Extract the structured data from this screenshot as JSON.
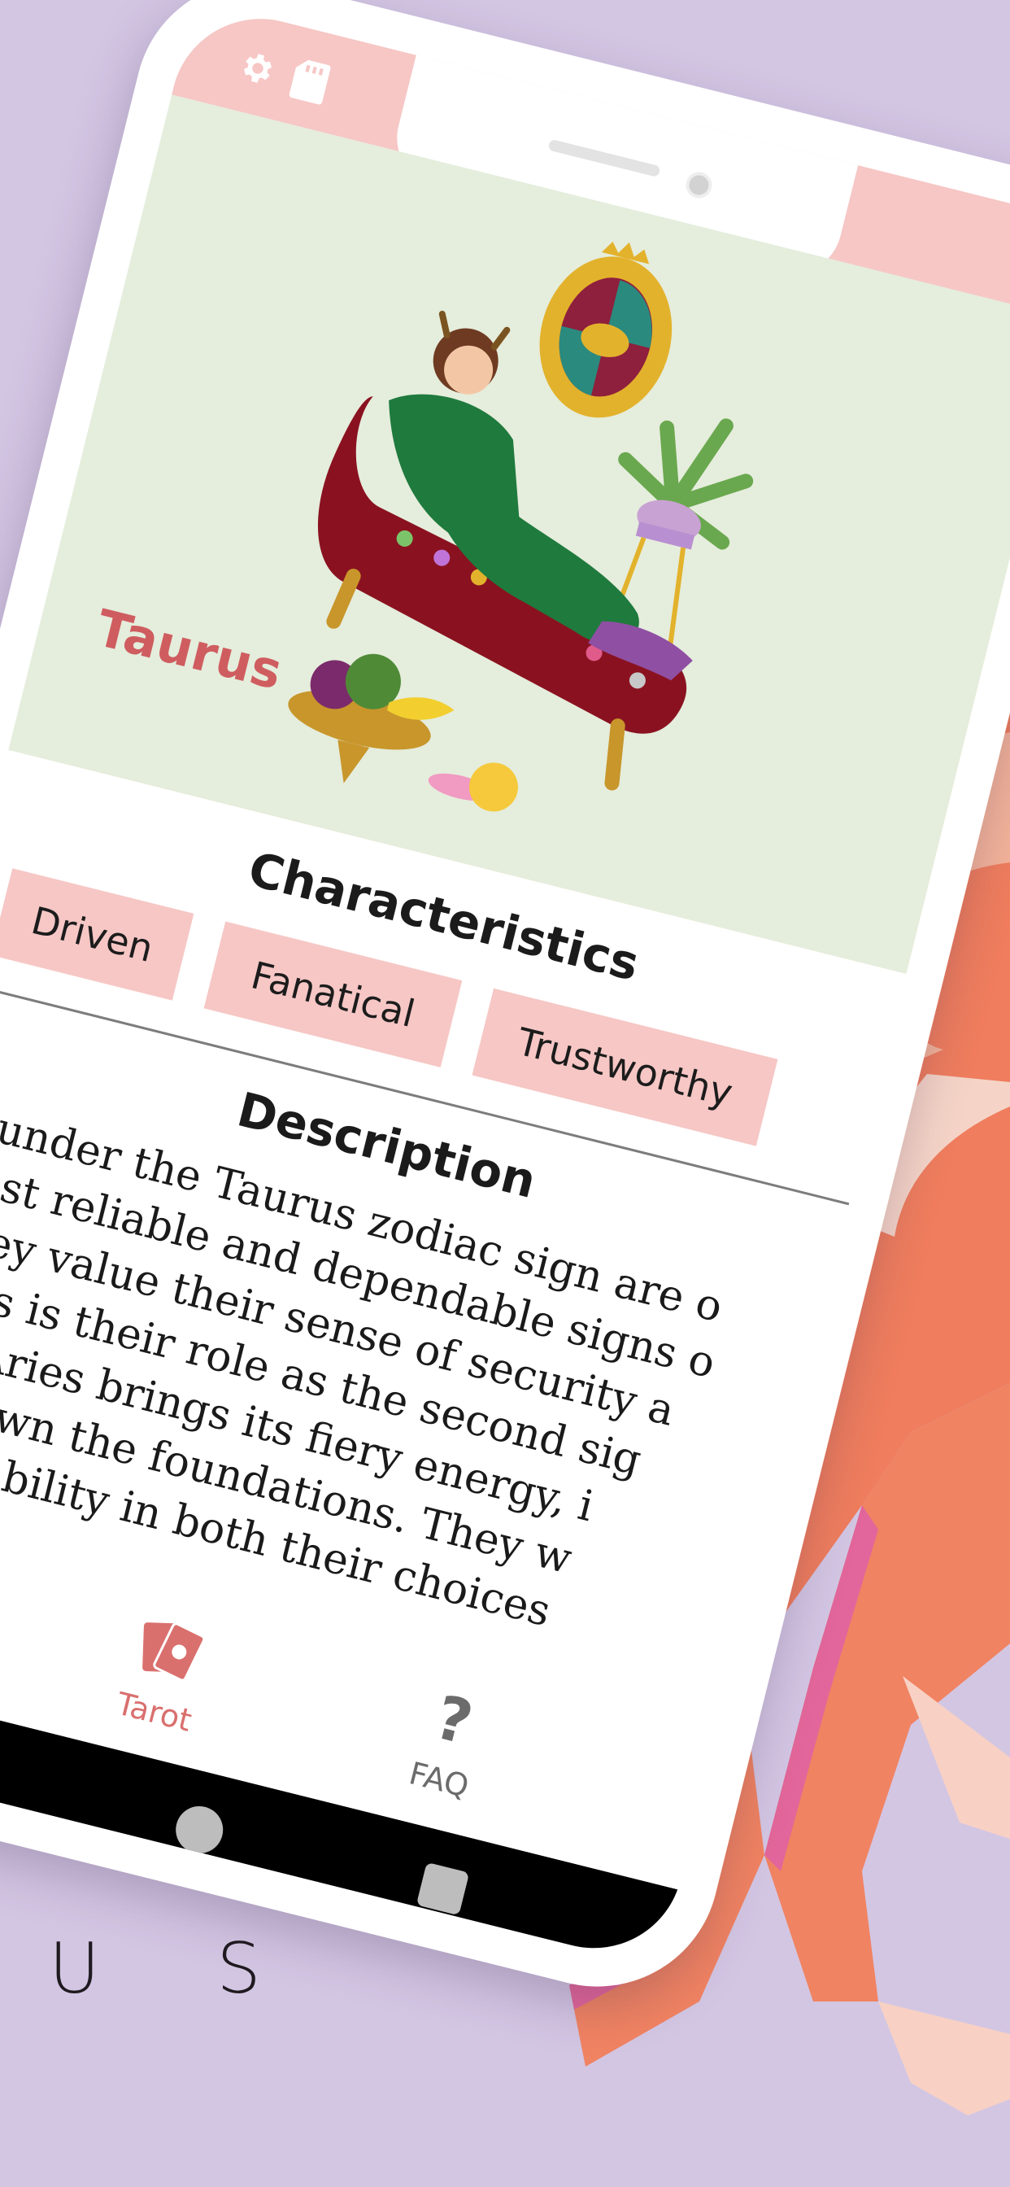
{
  "background": {
    "color": "#d3c6e3",
    "partial_word": "U S"
  },
  "screen": {
    "status_icons": [
      "gear-icon",
      "card-icon"
    ],
    "hero": {
      "sign_name": "Taurus",
      "accent_color": "#cf5d60",
      "background_color": "#e5eddc"
    },
    "characteristics": {
      "title": "Characteristics",
      "chips": [
        "Driven",
        "Fanatical",
        "Trustworthy"
      ],
      "chip_color": "#f6c7c5"
    },
    "description": {
      "title": "Description",
      "lines": [
        "born under the Taurus zodiac sign are o",
        "he most reliable and dependable signs o",
        "ac. They value their sense of security a",
        "and this is their role as the second sig",
        ". After Aries brings its fiery energy, i",
        "t lays down the foundations. They w",
        "ch for stability in both their choices"
      ]
    },
    "tabs": [
      {
        "label": "Tarot",
        "icon": "tarot-cards-icon",
        "active": true,
        "color": "#d9706e"
      },
      {
        "label": "FAQ",
        "icon": "question-icon",
        "active": false,
        "color": "#6b6b6b"
      }
    ],
    "system_nav": [
      "back-icon",
      "home-icon",
      "recents-icon"
    ]
  }
}
